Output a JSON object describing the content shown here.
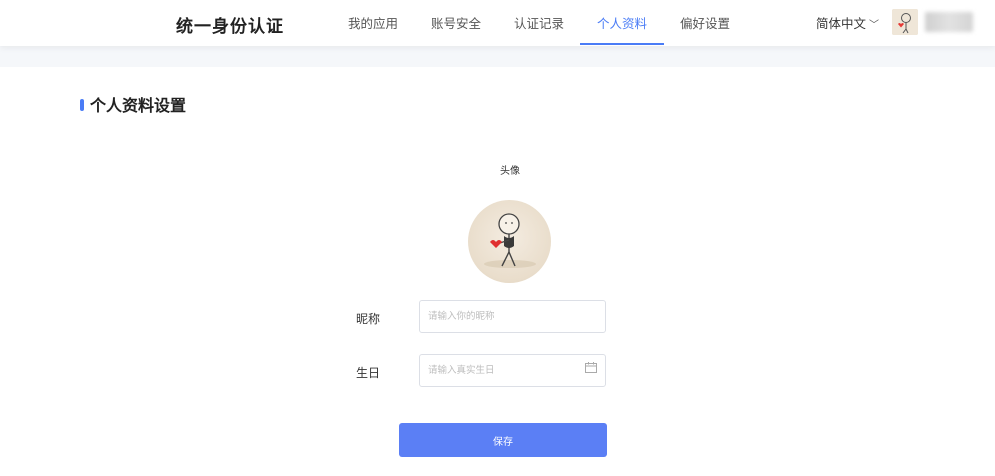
{
  "header": {
    "brand": "统一身份认证",
    "nav": [
      {
        "label": "我的应用"
      },
      {
        "label": "账号安全"
      },
      {
        "label": "认证记录"
      },
      {
        "label": "个人资料",
        "active": true
      },
      {
        "label": "偏好设置"
      }
    ],
    "language": "简体中文"
  },
  "page": {
    "section_title": "个人资料设置",
    "avatar_label": "头像",
    "fields": {
      "nickname": {
        "label": "昵称",
        "placeholder": "请输入你的昵称",
        "value": ""
      },
      "birthday": {
        "label": "生日",
        "placeholder": "请输入真实生日",
        "value": ""
      }
    },
    "save_label": "保存"
  },
  "colors": {
    "accent": "#4a7cf6",
    "button": "#5b7ff5",
    "band": "#f5f7fa"
  },
  "icons": [
    "chevron-down-icon",
    "calendar-icon",
    "user-avatar"
  ]
}
